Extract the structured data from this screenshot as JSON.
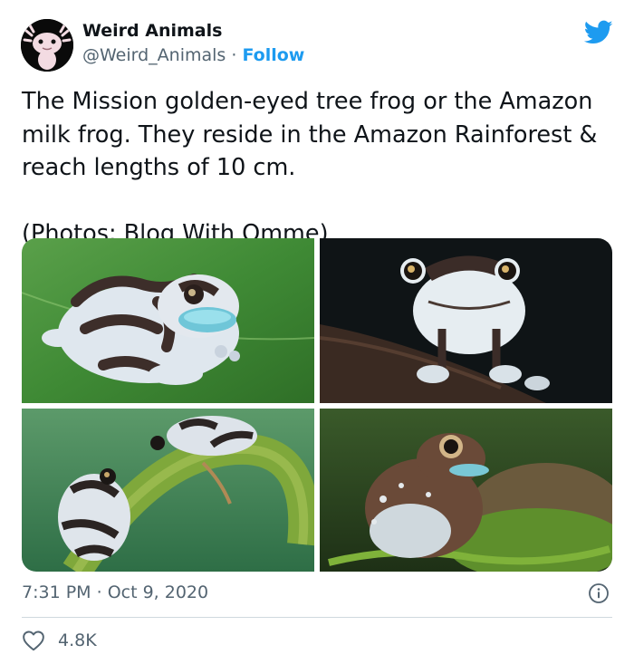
{
  "author": {
    "name": "Weird Animals",
    "handle": "@Weird_Animals",
    "separator": " · ",
    "follow_label": "Follow",
    "avatar_icon": "axolotl-avatar",
    "verified": false
  },
  "brand": {
    "icon": "twitter-bird-icon",
    "color": "#1d9bf0"
  },
  "tweet": {
    "text": "The Mission golden-eyed tree frog or the Amazon\nmilk frog. They reside in the Amazon Rainforest &\nreach lengths of 10 cm.\n\n(Photos: Blog With Omme)"
  },
  "media": {
    "count": 4,
    "photos": [
      {
        "subject": "milk frog on green leaf, blue mouth"
      },
      {
        "subject": "milk frog front view on branch, dark background"
      },
      {
        "subject": "two milk frogs on green stem"
      },
      {
        "subject": "milk frog on mossy rock"
      }
    ]
  },
  "meta": {
    "time": "7:31 PM",
    "separator": " · ",
    "date": "Oct 9, 2020",
    "info_icon": "info-icon"
  },
  "actions": {
    "like_icon": "heart-icon",
    "like_count": "4.8K"
  },
  "colors": {
    "text_primary": "#0f1419",
    "text_secondary": "#536471",
    "link": "#1d9bf0",
    "divider": "#cfd9de"
  }
}
